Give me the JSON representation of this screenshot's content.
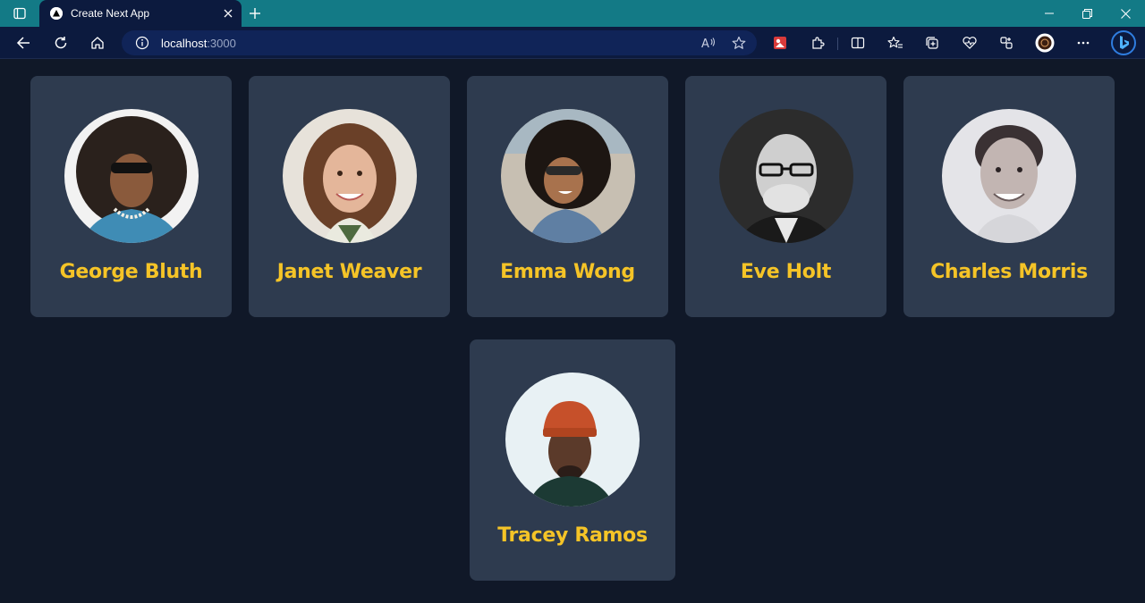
{
  "browser": {
    "tab_title": "Create Next App",
    "url_host": "localhost",
    "url_port": ":3000",
    "colors": {
      "titlebar": "#137a86",
      "toolbar": "#0c1a3e",
      "omnibox": "#102458",
      "page_background": "#101828",
      "card_background": "#2e3b4f",
      "name_color": "#f5c427"
    }
  },
  "users": [
    {
      "name": "George Bluth",
      "avatar": "man-long-curly-hair-sunglasses-photo",
      "tone": "#4a8fb5"
    },
    {
      "name": "Janet Weaver",
      "avatar": "smiling-woman-brown-hair-photo",
      "tone": "#d8d0c6"
    },
    {
      "name": "Emma Wong",
      "avatar": "woman-curly-hair-sunglasses-photo",
      "tone": "#9db6c6"
    },
    {
      "name": "Eve Holt",
      "avatar": "bald-man-glasses-grayscale-photo",
      "tone": "#3a3a3a"
    },
    {
      "name": "Charles Morris",
      "avatar": "smiling-man-grayscale-photo",
      "tone": "#c9c9ce"
    },
    {
      "name": "Tracey Ramos",
      "avatar": "man-orange-beanie-photo",
      "tone": "#e8f1f4"
    }
  ]
}
